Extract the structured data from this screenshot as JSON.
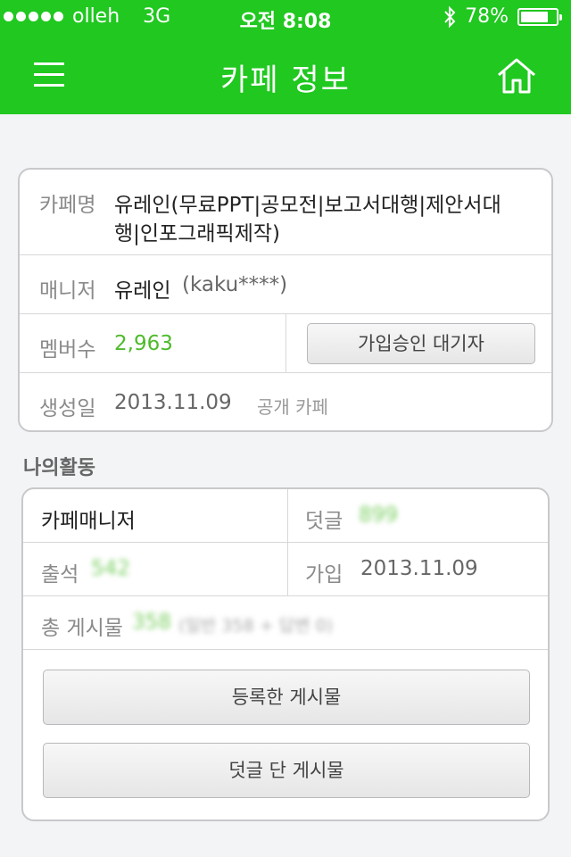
{
  "status_bar": {
    "carrier": "olleh",
    "network": "3G",
    "time": "오전 8:08",
    "battery_percent": "78%",
    "battery_level": 0.78
  },
  "nav": {
    "title": "카페 정보",
    "menu_icon": "hamburger-menu-icon",
    "home_icon": "home-icon"
  },
  "cafe_info": {
    "name_label": "카페명",
    "name_line1": "유레인(무료PPT|공모전|보고서대행|제안서대",
    "name_line2": "행|인포그래픽제작)",
    "manager_label": "매니저",
    "manager_name": "유레인",
    "manager_id": "(kaku****)",
    "members_label": "멤버수",
    "members_count": "2,963",
    "pending_button": "가입승인 대기자",
    "created_label": "생성일",
    "created_date": "2013.11.09",
    "visibility": "공개 카페"
  },
  "my_activity": {
    "section_title": "나의활동",
    "role": "카페매니저",
    "comments_label": "덧글",
    "comments_value": "899",
    "attendance_label": "출석",
    "attendance_value": "542",
    "joined_label": "가입",
    "joined_date": "2013.11.09",
    "posts_label": "총 게시물",
    "posts_value": "358",
    "posts_detail": "(일반 358 + 답변 0)",
    "my_posts_button": "등록한 게시물",
    "my_comments_button": "덧글 단 게시물"
  },
  "colors": {
    "brand_green": "#20c820",
    "value_green": "#4fba2c"
  }
}
